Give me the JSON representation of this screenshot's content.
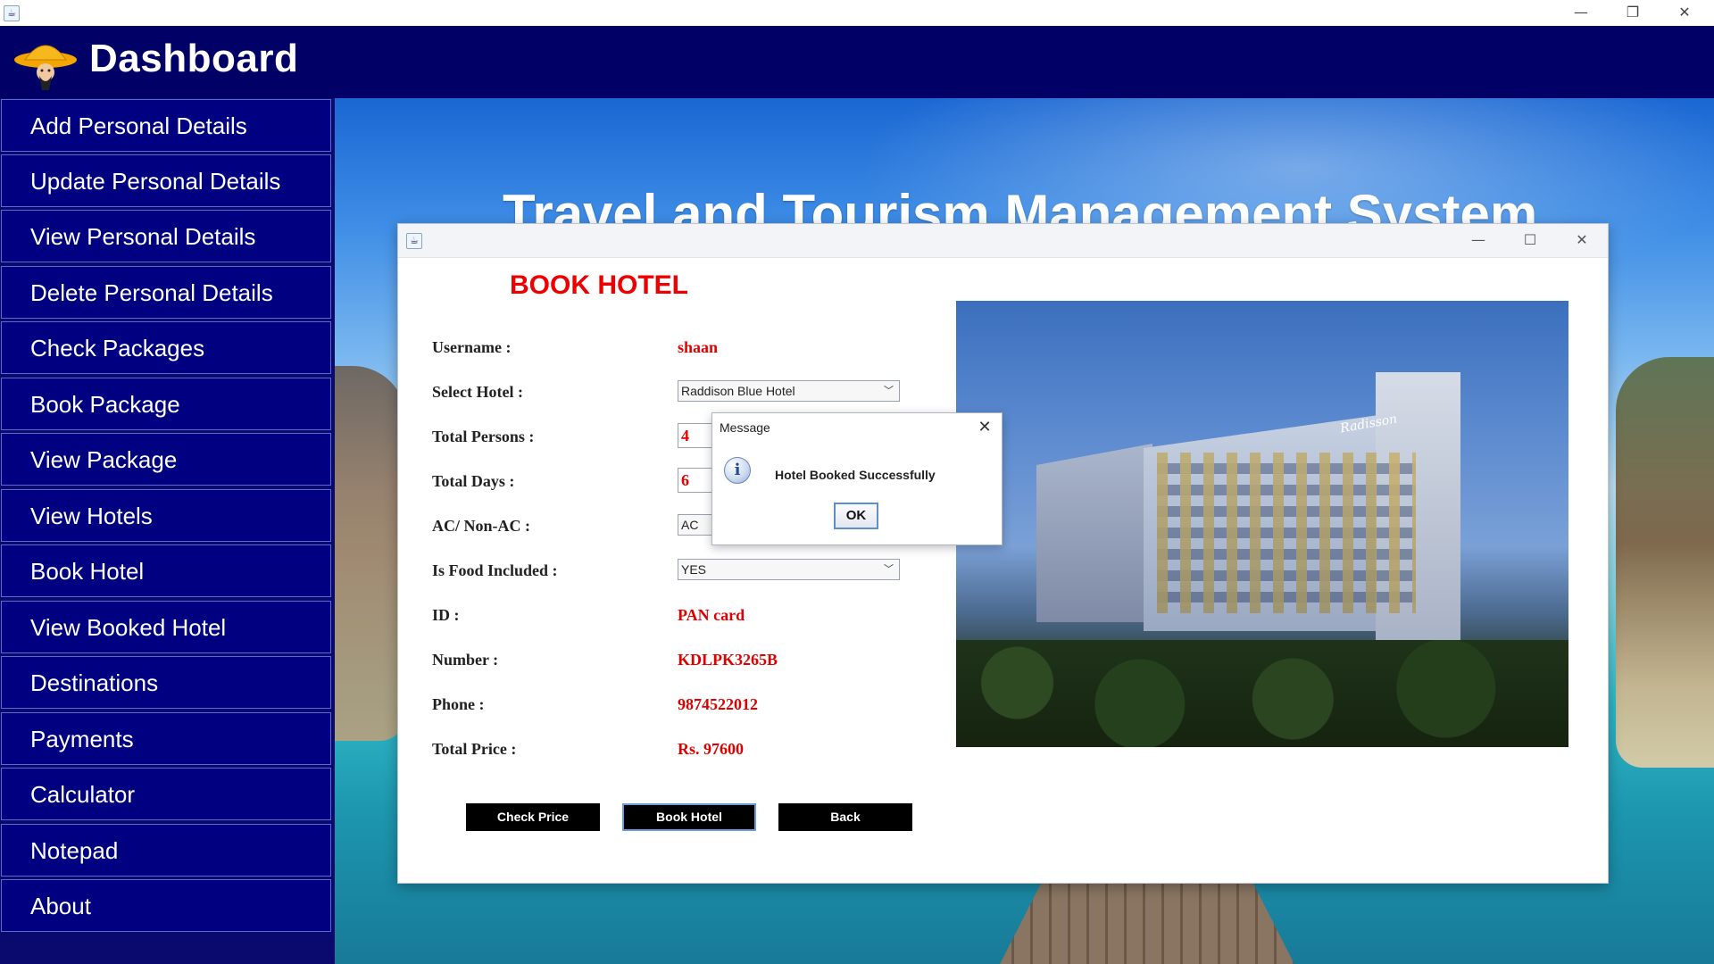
{
  "os_window": {
    "minimize": "—",
    "restore": "❐",
    "close": "✕"
  },
  "dashboard": {
    "title": "Dashboard"
  },
  "sidebar": {
    "items": [
      {
        "label": "Add Personal Details"
      },
      {
        "label": "Update Personal Details"
      },
      {
        "label": "View Personal Details"
      },
      {
        "label": "Delete Personal Details"
      },
      {
        "label": "Check Packages"
      },
      {
        "label": "Book Package"
      },
      {
        "label": "View Package"
      },
      {
        "label": "View Hotels"
      },
      {
        "label": "Book Hotel"
      },
      {
        "label": "View Booked Hotel"
      },
      {
        "label": "Destinations"
      },
      {
        "label": "Payments"
      },
      {
        "label": "Calculator"
      },
      {
        "label": "Notepad"
      },
      {
        "label": "About"
      }
    ]
  },
  "main": {
    "system_title": "Travel and Tourism Management System"
  },
  "book_hotel": {
    "window_controls": {
      "minimize": "—",
      "maximize": "☐",
      "close": "✕"
    },
    "heading": "BOOK HOTEL",
    "labels": {
      "username": "Username :",
      "select_hotel": "Select Hotel :",
      "total_persons": "Total Persons :",
      "total_days": "Total Days :",
      "ac": "AC/ Non-AC :",
      "food": "Is Food Included :",
      "id": "ID :",
      "number": "Number :",
      "phone": "Phone :",
      "total_price": "Total Price :"
    },
    "values": {
      "username": "shaan",
      "select_hotel": "Raddison Blue Hotel",
      "total_persons": "4",
      "total_days": "6",
      "ac": "AC",
      "food": "YES",
      "id": "PAN card",
      "number": "KDLPK3265B",
      "phone": "9874522012",
      "total_price": "Rs. 97600"
    },
    "buttons": {
      "check_price": "Check Price",
      "book_hotel": "Book Hotel",
      "back": "Back"
    },
    "photo_brand": "Radisson"
  },
  "message_dialog": {
    "title": "Message",
    "close": "✕",
    "icon": "i",
    "text": "Hotel Booked Successfully",
    "ok": "OK"
  },
  "colors": {
    "sidebar_bg": "#000080",
    "header_bg": "#000066",
    "accent_red": "#ee0000"
  }
}
